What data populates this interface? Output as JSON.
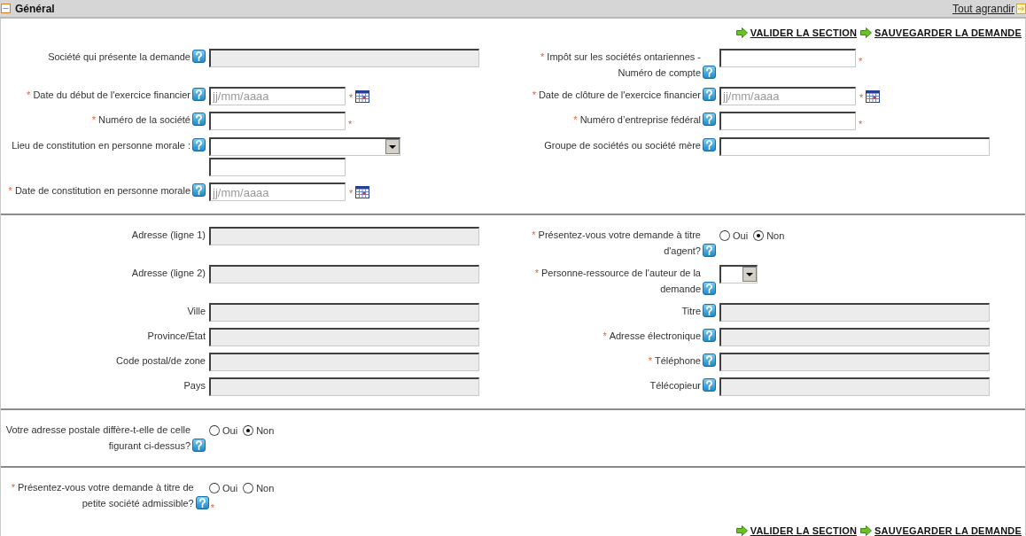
{
  "header": {
    "title": "Général",
    "expanded": true,
    "expand_link": "Tout agrandir"
  },
  "actions_top": [
    "VALIDER LA SECTION",
    "SAUVEGARDER LA DEMANDE"
  ],
  "sections": [
    {
      "rows": [
        {
          "left": {
            "kind": "longtext",
            "label": "Société qui présente la demande",
            "help": true,
            "disabled": true
          },
          "right": {
            "kind": "shorttext",
            "required": "*",
            "label": "Impôt sur les sociétés ontariennes - Numéro de compte",
            "help": true,
            "disabled": false,
            "after": "*"
          }
        },
        {
          "left": {
            "kind": "date",
            "required": "*",
            "label": "Date du début de l'exercice financier",
            "help": true,
            "placeholder": "jj/mm/aaaa",
            "after": "*"
          },
          "right": {
            "kind": "date",
            "required": "*",
            "label": "Date de clôture de l'exercice financier",
            "help": true,
            "placeholder": "jj/mm/aaaa",
            "after": "*"
          }
        },
        {
          "left": {
            "kind": "shorttext",
            "required": "*",
            "label": "Numéro de la société",
            "help": true,
            "disabled": false,
            "after": "*"
          },
          "right": {
            "kind": "shorttext",
            "required": "*",
            "label": "Numéro d’entreprise fédéral",
            "help": true,
            "disabled": false,
            "after": "*"
          }
        },
        {
          "left": {
            "kind": "selecttext",
            "label": "Lieu de constitution en personne morale :",
            "help": true
          },
          "right": {
            "kind": "longtext",
            "label": "Groupe de sociétés ou société mère",
            "help": true,
            "disabled": false
          }
        },
        {
          "left": {
            "kind": "date",
            "required": "*",
            "label": "Date de constitution en personne morale",
            "help": true,
            "placeholder": "jj/mm/aaaa",
            "after": "*"
          }
        }
      ]
    },
    {
      "rows": [
        {
          "left": {
            "kind": "longtext",
            "label": "Adresse (ligne 1)",
            "help": false,
            "disabled": true
          },
          "right": {
            "kind": "radio",
            "required": "*",
            "label": "Présentez-vous votre demande à titre d'agent?",
            "help": true,
            "options": [
              {
                "label": "Oui",
                "selected": false
              },
              {
                "label": "Non",
                "selected": true
              }
            ]
          }
        },
        {
          "left": {
            "kind": "longtext",
            "label": "Adresse (ligne 2)",
            "help": false,
            "disabled": true
          },
          "right": {
            "kind": "tinyselect",
            "required": "*",
            "label": "Personne-ressource de l'auteur de la demande",
            "help": true
          }
        },
        {
          "left": {
            "kind": "longtext",
            "label": "Ville",
            "help": false,
            "disabled": true
          },
          "right": {
            "kind": "longtext",
            "label": "Titre",
            "help": true,
            "disabled": true
          }
        },
        {
          "left": {
            "kind": "longtext",
            "label": "Province/État",
            "help": false,
            "disabled": true
          },
          "right": {
            "kind": "longtext",
            "required": "*",
            "label": "Adresse électronique",
            "help": true,
            "disabled": true
          }
        },
        {
          "left": {
            "kind": "longtext",
            "label": "Code postal/de zone",
            "help": false,
            "disabled": true
          },
          "right": {
            "kind": "longtext",
            "required": "*",
            "label": "Téléphone",
            "help": true,
            "disabled": true
          }
        },
        {
          "left": {
            "kind": "longtext",
            "label": "Pays",
            "help": false,
            "disabled": true
          },
          "right": {
            "kind": "longtext",
            "label": "Télécopieur",
            "help": true,
            "disabled": true
          }
        }
      ]
    },
    {
      "rows": [
        {
          "left": {
            "kind": "radio",
            "label": "Votre adresse postale diffère-t-elle de celle figurant ci-dessus?",
            "help": true,
            "options": [
              {
                "label": "Oui",
                "selected": false
              },
              {
                "label": "Non",
                "selected": true
              }
            ]
          }
        }
      ]
    },
    {
      "rows": [
        {
          "left": {
            "kind": "radio",
            "required": "*",
            "label": "Présentez-vous votre demande à titre de petite société admissible?",
            "help": true,
            "help_after": "*",
            "options": [
              {
                "label": "Oui",
                "selected": false
              },
              {
                "label": "Non",
                "selected": false
              }
            ]
          }
        }
      ]
    }
  ],
  "actions_bottom": [
    "VALIDER LA SECTION",
    "SAUVEGARDER LA DEMANDE"
  ]
}
